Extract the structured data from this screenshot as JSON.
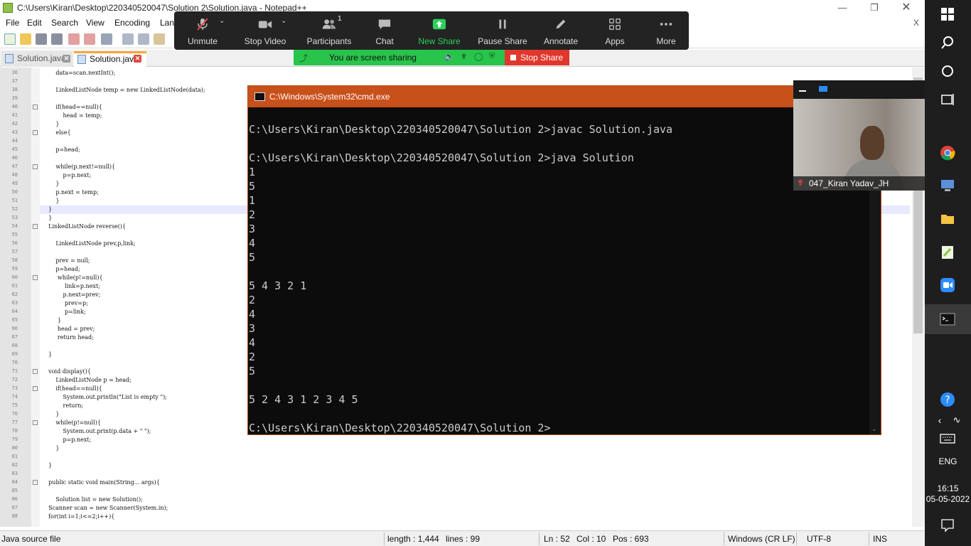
{
  "notepad": {
    "title": "C:\\Users\\Kiran\\Desktop\\220340520047\\Solution 2\\Solution.java - Notepad++",
    "menu": [
      "File",
      "Edit",
      "Search",
      "View",
      "Encoding",
      "Lan"
    ],
    "menu_close": "X",
    "tabs": [
      {
        "label": "Solution.java",
        "active": false
      },
      {
        "label": "Solution.java",
        "active": true
      }
    ],
    "code_lines": [
      {
        "n": "36",
        "t": "        data=scan.nextInt();"
      },
      {
        "n": "37",
        "t": ""
      },
      {
        "n": "38",
        "t": "        LinkedListNode temp = new LinkedListNode(data);"
      },
      {
        "n": "39",
        "t": ""
      },
      {
        "n": "40",
        "t": "        if(head==null){"
      },
      {
        "n": "41",
        "t": "            head = temp;"
      },
      {
        "n": "42",
        "t": "        }"
      },
      {
        "n": "43",
        "t": "        else{"
      },
      {
        "n": "44",
        "t": ""
      },
      {
        "n": "45",
        "t": "        p=head;"
      },
      {
        "n": "46",
        "t": ""
      },
      {
        "n": "47",
        "t": "        while(p.next!=null){"
      },
      {
        "n": "48",
        "t": "            p=p.next;"
      },
      {
        "n": "49",
        "t": "        }"
      },
      {
        "n": "50",
        "t": "        p.next = temp;"
      },
      {
        "n": "51",
        "t": "        }"
      },
      {
        "n": "52",
        "t": "    }"
      },
      {
        "n": "53",
        "t": "    }"
      },
      {
        "n": "54",
        "t": "    LinkedListNode reverse(){"
      },
      {
        "n": "55",
        "t": ""
      },
      {
        "n": "56",
        "t": "        LinkedListNode prev,p,link;"
      },
      {
        "n": "57",
        "t": ""
      },
      {
        "n": "58",
        "t": "        prev = null;"
      },
      {
        "n": "59",
        "t": "        p=head;"
      },
      {
        "n": "60",
        "t": "         while(p!=null){"
      },
      {
        "n": "61",
        "t": "             link=p.next;"
      },
      {
        "n": "62",
        "t": "            p.next=prev;"
      },
      {
        "n": "63",
        "t": "             prev=p;"
      },
      {
        "n": "64",
        "t": "             p=link;"
      },
      {
        "n": "65",
        "t": "         }"
      },
      {
        "n": "66",
        "t": "         head = prev;"
      },
      {
        "n": "67",
        "t": "         return head;"
      },
      {
        "n": "68",
        "t": ""
      },
      {
        "n": "69",
        "t": "    }"
      },
      {
        "n": "70",
        "t": ""
      },
      {
        "n": "71",
        "t": "    void display(){"
      },
      {
        "n": "72",
        "t": "        LinkedListNode p = head;"
      },
      {
        "n": "73",
        "t": "        if(head==null){"
      },
      {
        "n": "74",
        "t": "            System.out.println(\"List is empty \");"
      },
      {
        "n": "75",
        "t": "            return;"
      },
      {
        "n": "76",
        "t": "        }"
      },
      {
        "n": "77",
        "t": "        while(p!=null){"
      },
      {
        "n": "78",
        "t": "            System.out.print(p.data + \" \");"
      },
      {
        "n": "79",
        "t": "            p=p.next;"
      },
      {
        "n": "80",
        "t": "        }"
      },
      {
        "n": "81",
        "t": ""
      },
      {
        "n": "82",
        "t": "    }"
      },
      {
        "n": "83",
        "t": ""
      },
      {
        "n": "84",
        "t": "    public static void main(String... args){"
      },
      {
        "n": "85",
        "t": ""
      },
      {
        "n": "86",
        "t": "        Solution list = new Solution();"
      },
      {
        "n": "87",
        "t": "    Scanner scan = new Scanner(System.in);"
      },
      {
        "n": "88",
        "t": "    for(int i=1;i<=2;i++){"
      }
    ],
    "status": {
      "file_type": "Java source file",
      "length": "length : 1,444",
      "lines": "lines : 99",
      "ln": "Ln : 52",
      "col": "Col : 10",
      "pos": "Pos : 693",
      "eol": "Windows (CR LF)",
      "encoding": "UTF-8",
      "mode": "INS"
    }
  },
  "zoom": {
    "buttons": [
      {
        "label": "Unmute",
        "icon": "mic-muted-icon"
      },
      {
        "label": "Stop Video",
        "icon": "video-camera-icon"
      },
      {
        "label": "Participants",
        "icon": "participants-icon",
        "badge": "1"
      },
      {
        "label": "Chat",
        "icon": "chat-icon"
      },
      {
        "label": "New Share",
        "icon": "share-arrow-icon"
      },
      {
        "label": "Pause Share",
        "icon": "pause-icon"
      },
      {
        "label": "Annotate",
        "icon": "pencil-icon"
      },
      {
        "label": "Apps",
        "icon": "apps-icon"
      },
      {
        "label": "More",
        "icon": "more-dots-icon"
      }
    ],
    "sharing_text": "You are screen sharing",
    "stop_share": "Stop Share",
    "new_share_color": "#2bd15c",
    "participant_name": "047_Kiran Yadav_JH"
  },
  "cmd": {
    "title": "C:\\Windows\\System32\\cmd.exe",
    "lines": [
      "",
      "C:\\Users\\Kiran\\Desktop\\220340520047\\Solution 2>javac Solution.java",
      "",
      "C:\\Users\\Kiran\\Desktop\\220340520047\\Solution 2>java Solution",
      "1",
      "5",
      "1",
      "2",
      "3",
      "4",
      "5",
      "",
      "5 4 3 2 1",
      "2",
      "4",
      "3",
      "4",
      "2",
      "5",
      "",
      "5 2 4 3 1 2 3 4 5",
      "",
      "C:\\Users\\Kiran\\Desktop\\220340520047\\Solution 2>"
    ]
  },
  "taskbar": {
    "language": "ENG",
    "time": "16:15",
    "date": "05-05-2022"
  }
}
